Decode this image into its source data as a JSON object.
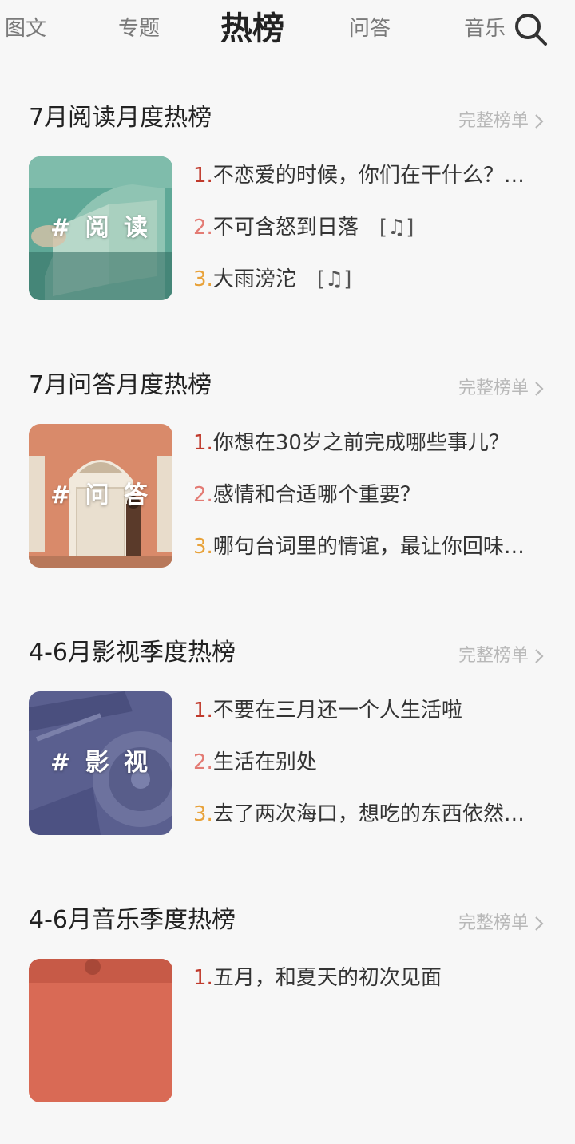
{
  "nav": {
    "tabs": [
      "图文",
      "专题",
      "热榜",
      "问答",
      "音乐"
    ],
    "active_index": 2
  },
  "icons": {
    "search": "search-icon",
    "chevron": "chevron-right-icon"
  },
  "colors": {
    "rank1": "#c0392b",
    "rank2": "#e37b74",
    "rank3": "#e8a23a",
    "link": "#b8b8b8"
  },
  "sections": [
    {
      "title": "7月阅读月度热榜",
      "link": "完整榜单",
      "cover_label": "# 阅 读",
      "items": [
        {
          "rank": "1.",
          "text": "不恋爱的时候，你们在干什么？…",
          "tag": ""
        },
        {
          "rank": "2.",
          "text": "不可含怒到日落",
          "tag": "[♫]"
        },
        {
          "rank": "3.",
          "text": "大雨滂沱",
          "tag": "[♫]"
        }
      ]
    },
    {
      "title": "7月问答月度热榜",
      "link": "完整榜单",
      "cover_label": "# 问 答",
      "items": [
        {
          "rank": "1.",
          "text": "你想在30岁之前完成哪些事儿？",
          "tag": ""
        },
        {
          "rank": "2.",
          "text": "感情和合适哪个重要？",
          "tag": ""
        },
        {
          "rank": "3.",
          "text": "哪句台词里的情谊，最让你回味…",
          "tag": ""
        }
      ]
    },
    {
      "title": "4-6月影视季度热榜",
      "link": "完整榜单",
      "cover_label": "# 影 视",
      "items": [
        {
          "rank": "1.",
          "text": "不要在三月还一个人生活啦",
          "tag": ""
        },
        {
          "rank": "2.",
          "text": "生活在别处",
          "tag": ""
        },
        {
          "rank": "3.",
          "text": "去了两次海口，想吃的东西依然…",
          "tag": ""
        }
      ]
    },
    {
      "title": "4-6月音乐季度热榜",
      "link": "完整榜单",
      "cover_label": "",
      "items": [
        {
          "rank": "1.",
          "text": "五月，和夏天的初次见面",
          "tag": ""
        }
      ]
    }
  ]
}
